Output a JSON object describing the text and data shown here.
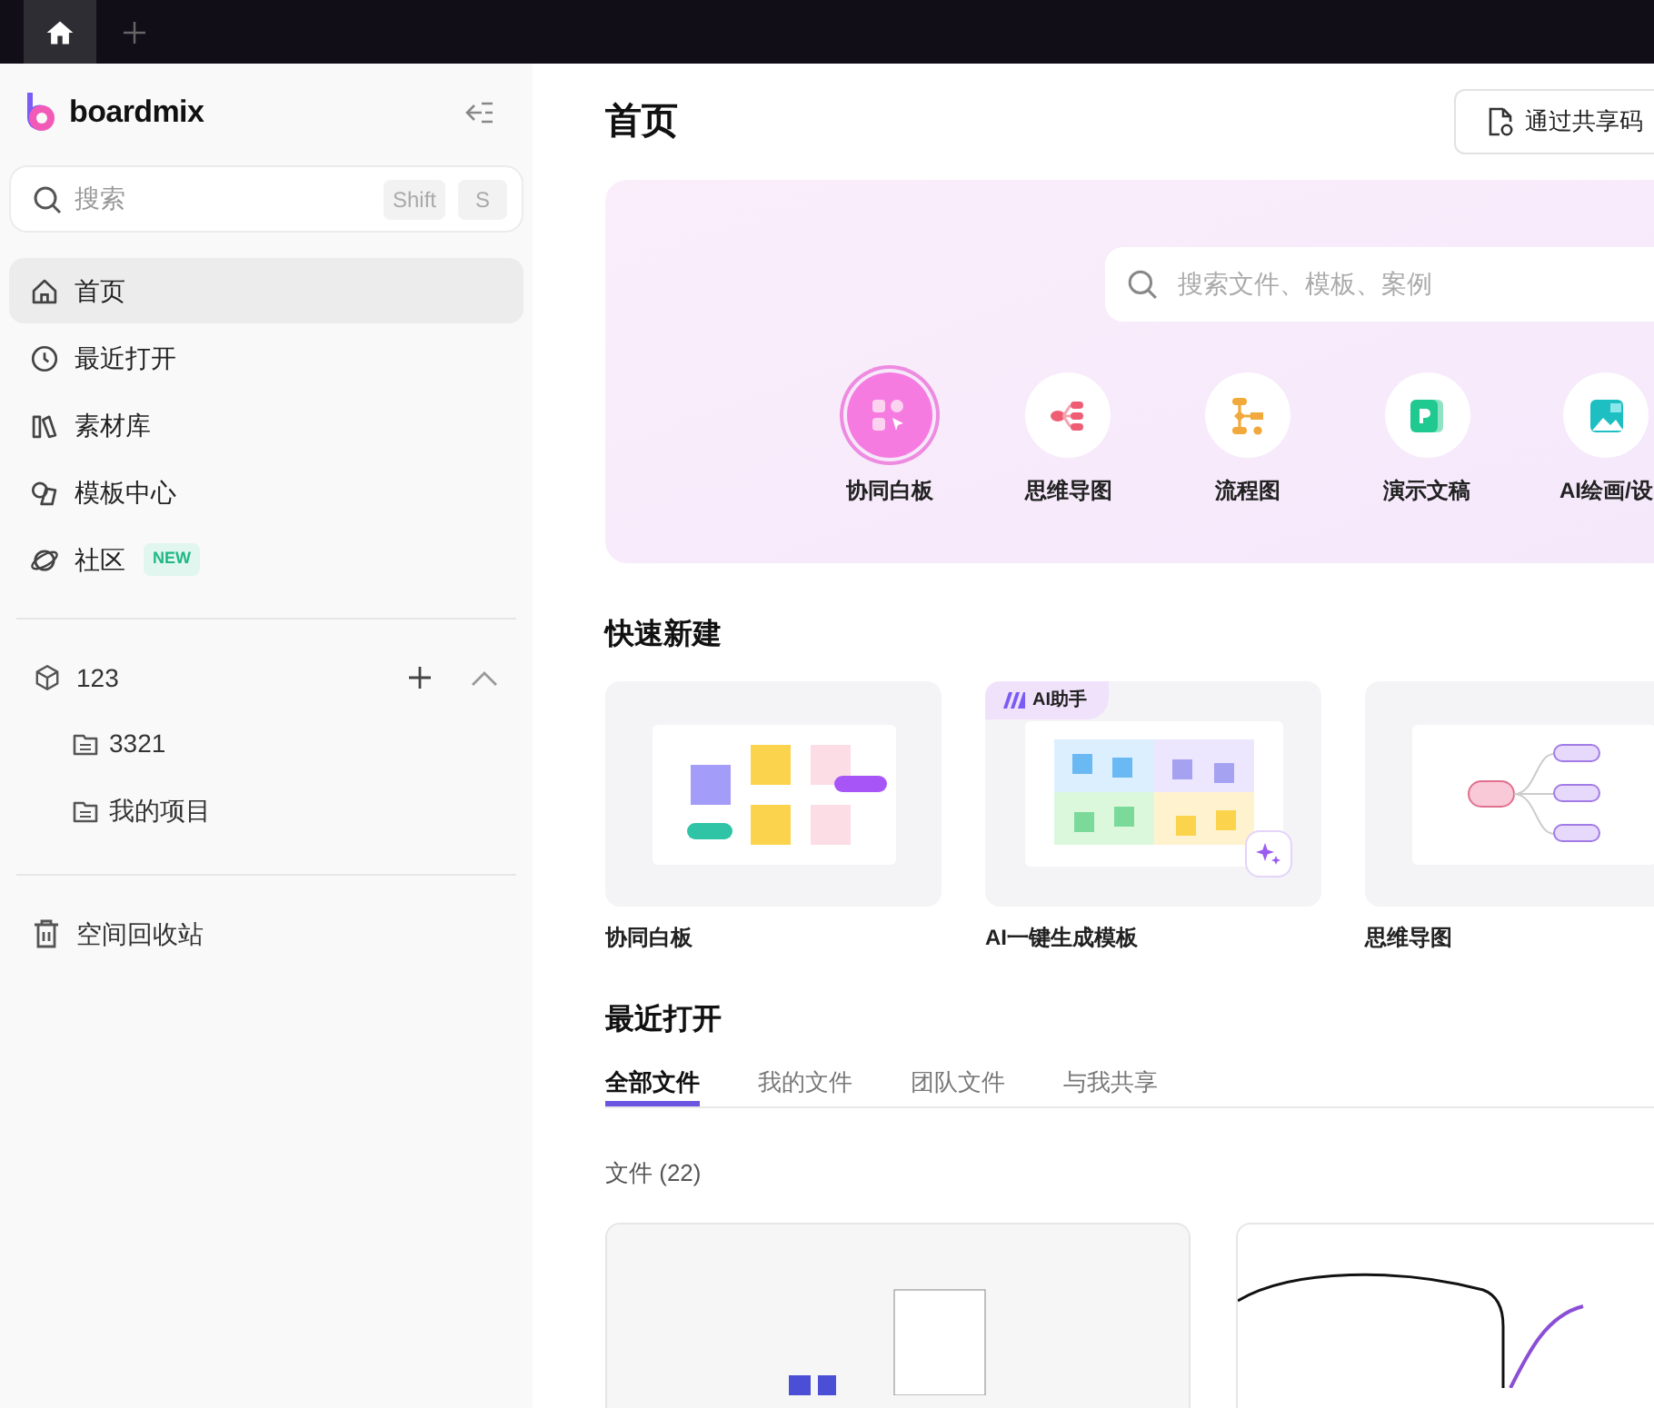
{
  "tab_bar": {
    "tabs": [
      {
        "kind": "home",
        "selected": true
      }
    ]
  },
  "sidebar": {
    "brand": "boardmix",
    "search": {
      "placeholder": "搜索",
      "keys": [
        "Shift",
        "S"
      ]
    },
    "nav": [
      {
        "label": "首页",
        "kind": "home",
        "selected": true
      },
      {
        "label": "最近打开",
        "kind": "clock",
        "selected": false
      },
      {
        "label": "素材库",
        "kind": "library",
        "selected": false
      },
      {
        "label": "模板中心",
        "kind": "shapes",
        "selected": false
      },
      {
        "label": "社区",
        "kind": "planet",
        "selected": false,
        "badge": "NEW"
      }
    ],
    "workspace": {
      "name": "123",
      "expanded": true,
      "children": [
        {
          "label": "3321"
        },
        {
          "label": "我的项目"
        }
      ]
    },
    "trash": "空间回收站"
  },
  "main": {
    "title": "首页",
    "share_button": "通过共享码",
    "hero": {
      "search_placeholder": "搜索文件、模板、案例",
      "types": [
        {
          "label": "协同白板",
          "kind": "whiteboard",
          "selected": true
        },
        {
          "label": "思维导图",
          "kind": "mindmap",
          "selected": false
        },
        {
          "label": "流程图",
          "kind": "flowchart",
          "selected": false
        },
        {
          "label": "演示文稿",
          "kind": "slides",
          "selected": false
        },
        {
          "label": "AI绘画/设",
          "kind": "ai",
          "selected": false
        }
      ]
    },
    "quick_create": {
      "title": "快速新建",
      "templates": [
        {
          "label": "协同白板",
          "kind": "whiteboard"
        },
        {
          "label": "AI一键生成模板",
          "kind": "ai_grid",
          "badge": "AI助手"
        },
        {
          "label": "思维导图",
          "kind": "mindmap"
        }
      ]
    },
    "recent": {
      "title": "最近打开",
      "tabs": [
        {
          "label": "全部文件",
          "selected": true
        },
        {
          "label": "我的文件",
          "selected": false
        },
        {
          "label": "团队文件",
          "selected": false
        },
        {
          "label": "与我共享",
          "selected": false
        }
      ],
      "count": "文件 (22)"
    }
  }
}
